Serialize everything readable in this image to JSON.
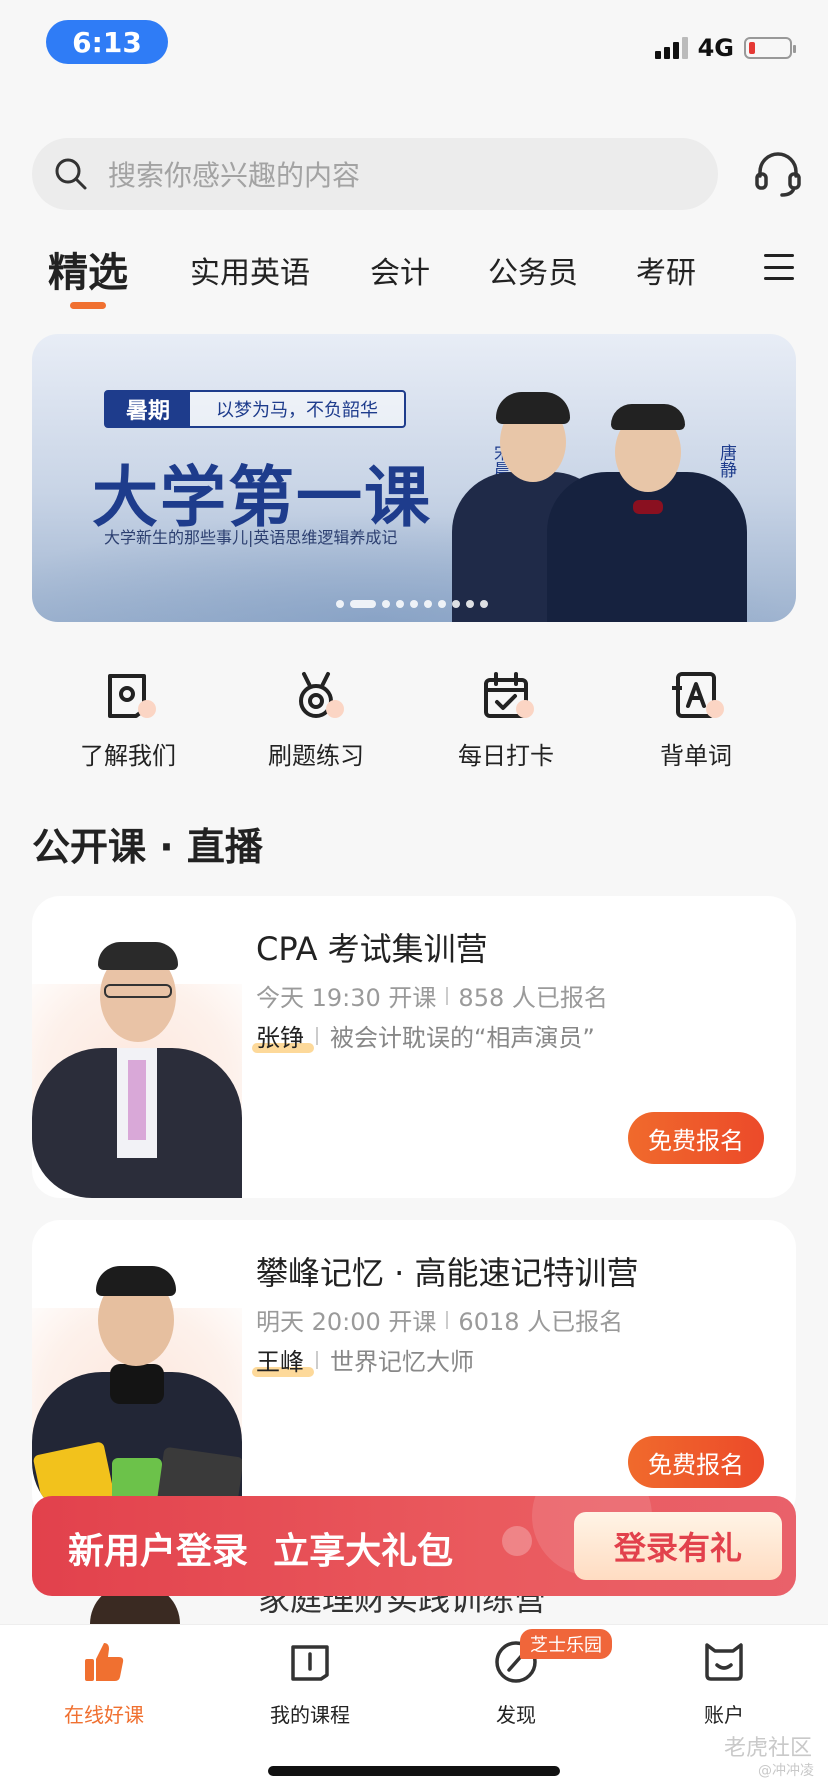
{
  "status_bar": {
    "time": "6:13",
    "network": "4G"
  },
  "search": {
    "placeholder": "搜索你感兴趣的内容"
  },
  "tabs": [
    {
      "label": "精选",
      "active": true
    },
    {
      "label": "实用英语"
    },
    {
      "label": "会计"
    },
    {
      "label": "公务员"
    },
    {
      "label": "考研"
    }
  ],
  "banner": {
    "tag": "暑期",
    "slogan": "以梦为马，不负韶华",
    "title": "大学第一课",
    "subtitle": "大学新生的那些事儿|英语思维逻辑养成记",
    "teacher_left": "宋晨",
    "teacher_right": "唐静",
    "slides_total": 10,
    "active_slide": 2
  },
  "quick_nav": [
    {
      "label": "了解我们",
      "icon": "about-us-icon"
    },
    {
      "label": "刷题练习",
      "icon": "medal-icon"
    },
    {
      "label": "每日打卡",
      "icon": "calendar-check-icon"
    },
    {
      "label": "背单词",
      "icon": "vocabulary-icon"
    }
  ],
  "section": {
    "title": "公开课 · 直播"
  },
  "courses": [
    {
      "title": "CPA 考试集训营",
      "time": "今天 19:30 开课",
      "enrolled": "858 人已报名",
      "teacher": "张铮",
      "teacher_desc": "被会计耽误的“相声演员”",
      "button": "免费报名"
    },
    {
      "title": "攀峰记忆 · 高能速记特训营",
      "time": "明天 20:00 开课",
      "enrolled": "6018 人已报名",
      "teacher": "王峰",
      "teacher_desc": "世界记忆大师",
      "button": "免费报名"
    }
  ],
  "peek_course_title": "家庭理财实践训练营",
  "promo": {
    "text": "新用户登录  立享大礼包",
    "button": "登录有礼"
  },
  "bottom_nav": [
    {
      "label": "在线好课",
      "icon": "thumbs-up-icon",
      "active": true
    },
    {
      "label": "我的课程",
      "icon": "book-icon"
    },
    {
      "label": "发现",
      "icon": "compass-icon",
      "badge": "芝士乐园"
    },
    {
      "label": "账户",
      "icon": "account-icon"
    }
  ],
  "watermark": {
    "main": "老虎社区",
    "sub": "@冲冲凌"
  },
  "colors": {
    "accent": "#f07030",
    "promo_red": "#e2414c",
    "time_pill": "#2f7cf6"
  }
}
